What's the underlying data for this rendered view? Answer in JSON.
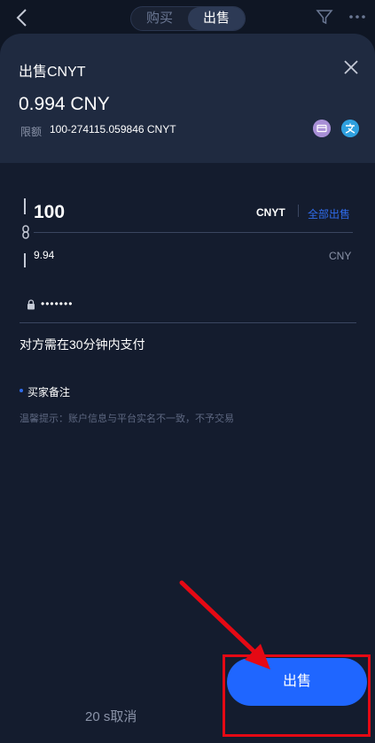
{
  "topbar": {
    "tab_buy": "购买",
    "tab_sell": "出售"
  },
  "sheet": {
    "title": "出售CNYT",
    "price": "0.994 CNY",
    "limit_label": "限额",
    "limit_value": "100-274115.059846 CNYT",
    "payment_methods": [
      "bank-card-icon",
      "alipay-icon"
    ]
  },
  "form": {
    "quantity": "100",
    "quantity_unit": "CNYT",
    "sell_all": "全部出售",
    "total": "9.94",
    "total_unit": "CNY",
    "password_mask": "•••••••",
    "pay_time_note": "对方需在30分钟内支付",
    "remark_label": "买家备注",
    "tip": "温馨提示：账户信息与平台实名不一致，不予交易"
  },
  "footer": {
    "cancel": "20 s取消",
    "sell_button": "出售"
  },
  "colors": {
    "accent": "#1f66ff",
    "highlight": "#e50914",
    "background": "#141c2e"
  }
}
